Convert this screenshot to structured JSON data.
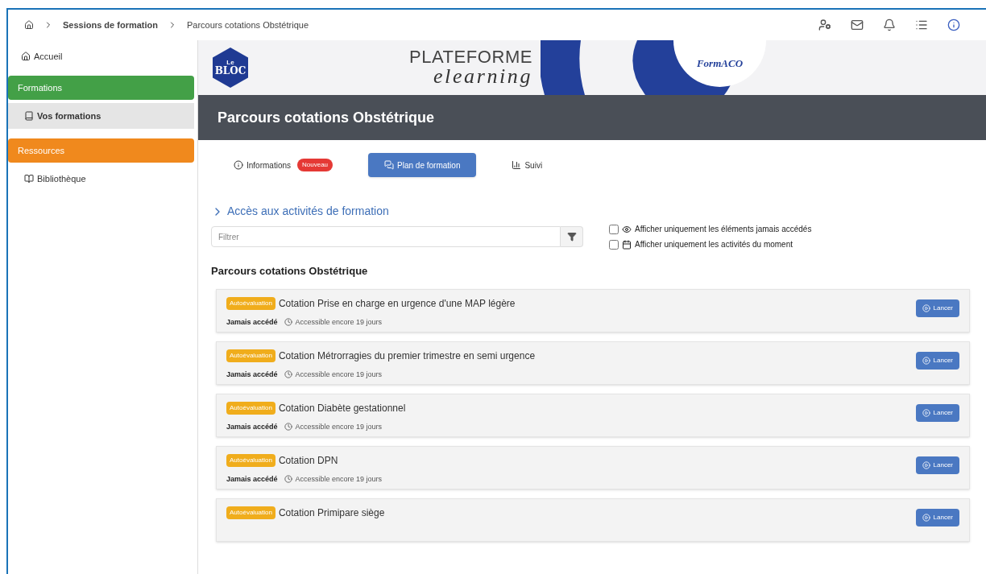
{
  "breadcrumb": [
    {
      "label": "Sessions de formation",
      "bold": true
    },
    {
      "label": "Parcours cotations Obstétrique",
      "bold": false
    }
  ],
  "sidebar": {
    "home": "Accueil",
    "sections": [
      {
        "label": "Formations",
        "color": "#43a047",
        "items": [
          {
            "label": "Vos formations",
            "selected": true
          }
        ]
      },
      {
        "label": "Ressources",
        "color": "#f0891d",
        "items": [
          {
            "label": "Bibliothèque",
            "selected": false
          }
        ]
      }
    ]
  },
  "banner": {
    "logo_top": "Le",
    "logo_bottom": "BLOC",
    "title": "PLATEFORME",
    "subtitle": "elearning",
    "partner": "FormACO"
  },
  "page_title": "Parcours cotations Obstétrique",
  "tabs": [
    {
      "label": "Informations",
      "badge": "Nouveau",
      "kind": "info",
      "selected": false
    },
    {
      "label": "Plan de formation",
      "kind": "chat",
      "selected": true
    },
    {
      "label": "Suivi",
      "kind": "chart",
      "selected": false
    }
  ],
  "section_title": "Accès aux activités de formation",
  "filter": {
    "placeholder": "Filtrer"
  },
  "options": [
    {
      "label": "Afficher uniquement les éléments jamais accédés",
      "kind": "eye",
      "checked": false
    },
    {
      "label": "Afficher uniquement les activités du moment",
      "kind": "calendar",
      "checked": false
    }
  ],
  "list_title": "Parcours cotations Obstétrique",
  "activities": [
    {
      "tag": "Autoévaluation",
      "title": "Cotation Prise en charge en urgence d'une MAP légère",
      "status": "Jamais accédé",
      "availability": "Accessible encore 19 jours",
      "button": "Lancer"
    },
    {
      "tag": "Autoévaluation",
      "title": "Cotation Métrorragies du premier trimestre en semi urgence",
      "status": "Jamais accédé",
      "availability": "Accessible encore 19 jours",
      "button": "Lancer"
    },
    {
      "tag": "Autoévaluation",
      "title": "Cotation Diabète gestationnel",
      "status": "Jamais accédé",
      "availability": "Accessible encore 19 jours",
      "button": "Lancer"
    },
    {
      "tag": "Autoévaluation",
      "title": "Cotation DPN",
      "status": "Jamais accédé",
      "availability": "Accessible encore 19 jours",
      "button": "Lancer"
    },
    {
      "tag": "Autoévaluation",
      "title": "Cotation Primipare siège",
      "button": "Lancer"
    }
  ]
}
